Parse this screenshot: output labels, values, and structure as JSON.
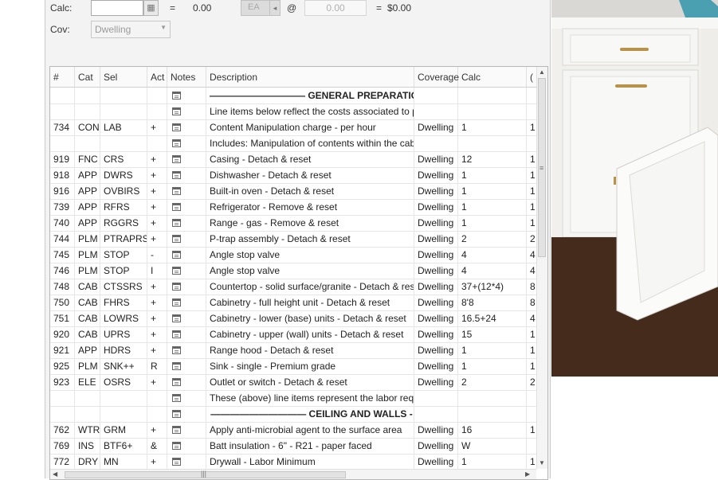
{
  "toolbar": {
    "calc_label": "Calc:",
    "calc_value": "",
    "equals1": "=",
    "qty_value": "0.00",
    "unit_value": "EA",
    "at_symbol": "@",
    "unit_price": "0.00",
    "equals2": "=",
    "total_value": "$0.00",
    "cov_label": "Cov:",
    "cov_value": "Dwelling"
  },
  "grid": {
    "columns": [
      "#",
      "Cat",
      "Sel",
      "Act",
      "Notes",
      "Description",
      "Coverage",
      "Calc",
      "("
    ],
    "rows": [
      {
        "num": "",
        "cat": "",
        "sel": "",
        "act": "",
        "desc": "—————————— GENERAL PREPARATION",
        "cov": "",
        "calc": "",
        "extra": "",
        "bold": true
      },
      {
        "num": "",
        "cat": "",
        "sel": "",
        "act": "",
        "desc": "Line items below reflect the costs associated to prepar",
        "cov": "",
        "calc": "",
        "extra": "",
        "bold": false
      },
      {
        "num": "734",
        "cat": "CON",
        "sel": "LAB",
        "act": "+",
        "desc": "Content Manipulation charge - per hour",
        "cov": "Dwelling",
        "calc": "1",
        "extra": "1",
        "bold": false
      },
      {
        "num": "",
        "cat": "",
        "sel": "",
        "act": "",
        "desc": "Includes: Manipulation of contents within the cabinets",
        "cov": "",
        "calc": "",
        "extra": "",
        "bold": false
      },
      {
        "num": "919",
        "cat": "FNC",
        "sel": "CRS",
        "act": "+",
        "desc": "Casing - Detach & reset",
        "cov": "Dwelling",
        "calc": "12",
        "extra": "1",
        "bold": false
      },
      {
        "num": "918",
        "cat": "APP",
        "sel": "DWRS",
        "act": "+",
        "desc": "Dishwasher - Detach & reset",
        "cov": "Dwelling",
        "calc": "1",
        "extra": "1",
        "bold": false
      },
      {
        "num": "916",
        "cat": "APP",
        "sel": "OVBIRS",
        "act": "+",
        "desc": "Built-in oven - Detach & reset",
        "cov": "Dwelling",
        "calc": "1",
        "extra": "1",
        "bold": false
      },
      {
        "num": "739",
        "cat": "APP",
        "sel": "RFRS",
        "act": "+",
        "desc": "Refrigerator - Remove & reset",
        "cov": "Dwelling",
        "calc": "1",
        "extra": "1",
        "bold": false
      },
      {
        "num": "740",
        "cat": "APP",
        "sel": "RGGRS",
        "act": "+",
        "desc": "Range - gas - Remove & reset",
        "cov": "Dwelling",
        "calc": "1",
        "extra": "1",
        "bold": false
      },
      {
        "num": "744",
        "cat": "PLM",
        "sel": "PTRAPRS",
        "act": "+",
        "desc": "P-trap assembly - Detach & reset",
        "cov": "Dwelling",
        "calc": "2",
        "extra": "2",
        "bold": false
      },
      {
        "num": "745",
        "cat": "PLM",
        "sel": "STOP",
        "act": "-",
        "desc": "Angle stop valve",
        "cov": "Dwelling",
        "calc": "4",
        "extra": "4",
        "bold": false
      },
      {
        "num": "746",
        "cat": "PLM",
        "sel": "STOP",
        "act": "I",
        "desc": "Angle stop valve",
        "cov": "Dwelling",
        "calc": "4",
        "extra": "4",
        "bold": false
      },
      {
        "num": "748",
        "cat": "CAB",
        "sel": "CTSSRS",
        "act": "+",
        "desc": "Countertop - solid surface/granite - Detach & reset",
        "cov": "Dwelling",
        "calc": "37+(12*4)",
        "extra": "8",
        "bold": false
      },
      {
        "num": "750",
        "cat": "CAB",
        "sel": "FHRS",
        "act": "+",
        "desc": "Cabinetry - full height unit - Detach & reset",
        "cov": "Dwelling",
        "calc": "8'8",
        "extra": "8",
        "bold": false
      },
      {
        "num": "751",
        "cat": "CAB",
        "sel": "LOWRS",
        "act": "+",
        "desc": "Cabinetry - lower (base) units - Detach & reset",
        "cov": "Dwelling",
        "calc": "16.5+24",
        "extra": "4",
        "bold": false
      },
      {
        "num": "920",
        "cat": "CAB",
        "sel": "UPRS",
        "act": "+",
        "desc": "Cabinetry - upper (wall) units - Detach & reset",
        "cov": "Dwelling",
        "calc": "15",
        "extra": "1",
        "bold": false
      },
      {
        "num": "921",
        "cat": "APP",
        "sel": "HDRS",
        "act": "+",
        "desc": "Range hood - Detach & reset",
        "cov": "Dwelling",
        "calc": "1",
        "extra": "1",
        "bold": false
      },
      {
        "num": "925",
        "cat": "PLM",
        "sel": "SNK++",
        "act": "R",
        "desc": "Sink - single - Premium grade",
        "cov": "Dwelling",
        "calc": "1",
        "extra": "1",
        "bold": false
      },
      {
        "num": "923",
        "cat": "ELE",
        "sel": "OSRS",
        "act": "+",
        "desc": "Outlet or switch - Detach & reset",
        "cov": "Dwelling",
        "calc": "2",
        "extra": "2",
        "bold": false
      },
      {
        "num": "",
        "cat": "",
        "sel": "",
        "act": "",
        "desc": "These (above) line items represent the labor required t",
        "cov": "",
        "calc": "",
        "extra": "",
        "bold": false
      },
      {
        "num": "",
        "cat": "",
        "sel": "",
        "act": "",
        "desc": "—————————— CEILING AND WALLS -",
        "cov": "",
        "calc": "",
        "extra": "",
        "bold": true
      },
      {
        "num": "762",
        "cat": "WTR",
        "sel": "GRM",
        "act": "+",
        "desc": "Apply anti-microbial agent to the surface area",
        "cov": "Dwelling",
        "calc": "16",
        "extra": "1",
        "bold": false
      },
      {
        "num": "769",
        "cat": "INS",
        "sel": "BTF6+",
        "act": "&",
        "desc": "Batt insulation - 6\" - R21 - paper faced",
        "cov": "Dwelling",
        "calc": "W",
        "extra": "",
        "bold": false
      },
      {
        "num": "772",
        "cat": "DRY",
        "sel": "MN",
        "act": "+",
        "desc": "Drywall - Labor Minimum",
        "cov": "Dwelling",
        "calc": "1",
        "extra": "1",
        "bold": false
      }
    ]
  },
  "icons": {
    "calculator": "calculator-icon",
    "notes": "notes-icon",
    "dropdown": "chevron-down-icon"
  },
  "colors": {
    "photo_cabinet": "#f4f4f2",
    "photo_floor": "#3b2416",
    "grid_border": "#b8b8b8"
  }
}
